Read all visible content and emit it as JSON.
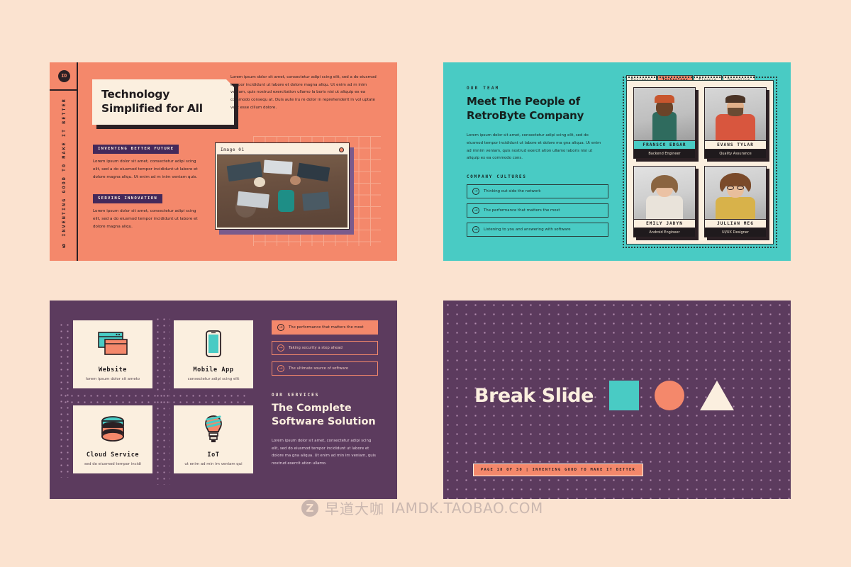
{
  "page": {
    "background": "#FBE3D0"
  },
  "slide1": {
    "bg": "#F4886B",
    "logo": "IO",
    "vertical_label": "INVENTING GOOD TO MAKE IT BETTER",
    "page_number": "9",
    "title": "Technology\nSimplified for All",
    "title_line1": "Technology",
    "title_line2": "Simplified for All",
    "right_paragraph": "Lorem ipsum dolor sit amet, consectetur adipi scing elit, sed a do eiusmod tempor incididunt ut labore et dolore magna aliqu. Ut enim ad m inim veniam, quis nostrud exercitation ullamo la boris nisi ut aliquip ex ea commodo consequ at. Duis aute iru re dolor in reprehenderit in vol uptate velit esse cillum dolore.",
    "blocks": [
      {
        "badge": "INVENTING BETTER FUTURE",
        "text": "Lorem ipsum dolor sit amet, consectetur adipi scing elit, sed a do eiusmod tempor incididunt ut labore et dolore magna aliqu. Ut enim ad m inim veniam quis."
      },
      {
        "badge": "SERVING INNOVATION",
        "text": "Lorem ipsum dolor sit amet, consectetur adipi scing elit, sed a do eiusmod tempor incididunt ut labore et dolore magna aliqu."
      }
    ],
    "image_card": {
      "label": "Image 01",
      "close_icon": "close-dot-icon"
    }
  },
  "slide2": {
    "bg": "#49CBC4",
    "kicker": "OUR TEAM",
    "title_line1": "Meet The People of",
    "title_line2": "RetroByte Company",
    "paragraph": "Lorem ipsum dolor sit amet, consectetur adipi scing elit, sed do eiusmod tempor incididunt ut labore et dolore ma gna aliqua. Ut enim ad minim veniam, quis nostrud exercit ation ullamo laboris nisi ut aliquip ex ea commodo cons.",
    "cultures_heading": "COMPANY CULTURES",
    "cultures": [
      "Thinking out side the network",
      "The performance that matters the most",
      "Listening to you and answering with software"
    ],
    "tabs": [
      {
        "label": "Business",
        "active": false
      },
      {
        "label": "Technology",
        "active": true
      },
      {
        "label": "Finance",
        "active": false
      },
      {
        "label": "Operation",
        "active": false
      }
    ],
    "members": [
      {
        "name": "FRANSCO EDGAR",
        "role": "Backend Engineer",
        "highlight": true
      },
      {
        "name": "EVANS TYLAR",
        "role": "Quality Assurance",
        "highlight": false
      },
      {
        "name": "EMILY JADYN",
        "role": "Android Engineer",
        "highlight": false
      },
      {
        "name": "JULLIAN MEG",
        "role": "UI/UX Designer",
        "highlight": false
      }
    ]
  },
  "slide3": {
    "bg": "#5C3B5E",
    "cards": [
      {
        "title": "Website",
        "subtitle": "lorem ipsum dolor sit ameto",
        "icon": "browser-windows-icon"
      },
      {
        "title": "Mobile App",
        "subtitle": "consectetur adipi scing elit",
        "icon": "smartphone-icon"
      },
      {
        "title": "Cloud Service",
        "subtitle": "sed do eiusmod tempor incidi",
        "icon": "database-stack-icon"
      },
      {
        "title": "IoT",
        "subtitle": "ut enim ad min im veniam qui",
        "icon": "lightbulb-icon"
      }
    ],
    "items": [
      {
        "label": "The performance that matters the most",
        "active": true
      },
      {
        "label": "Taking security a step ahead",
        "active": false
      },
      {
        "label": "The ultimate source of software",
        "active": false
      }
    ],
    "kicker": "OUR SERVICES",
    "title_line1": "The Complete",
    "title_line2": "Software Solution",
    "paragraph": "Lorem ipsum dolor sit amet, consectetur adipi scing elit, sed do eiusmod tempor incididunt ut labore et dolore ma gna aliqua. Ut enim ad min im veniam, quis nostrud exercit ation ullamo."
  },
  "slide4": {
    "bg": "#5C3B5E",
    "title": "Break Slide",
    "shapes": [
      "square-teal",
      "circle-salmon",
      "triangle-cream"
    ],
    "footer": "PAGE 18 OF 30  |  INVENTING GOOD TO MAKE IT BETTER"
  },
  "watermark": {
    "logo": "Z",
    "chinese": "早道大咖",
    "english": "IAMDK.TAOBAO.COM"
  }
}
